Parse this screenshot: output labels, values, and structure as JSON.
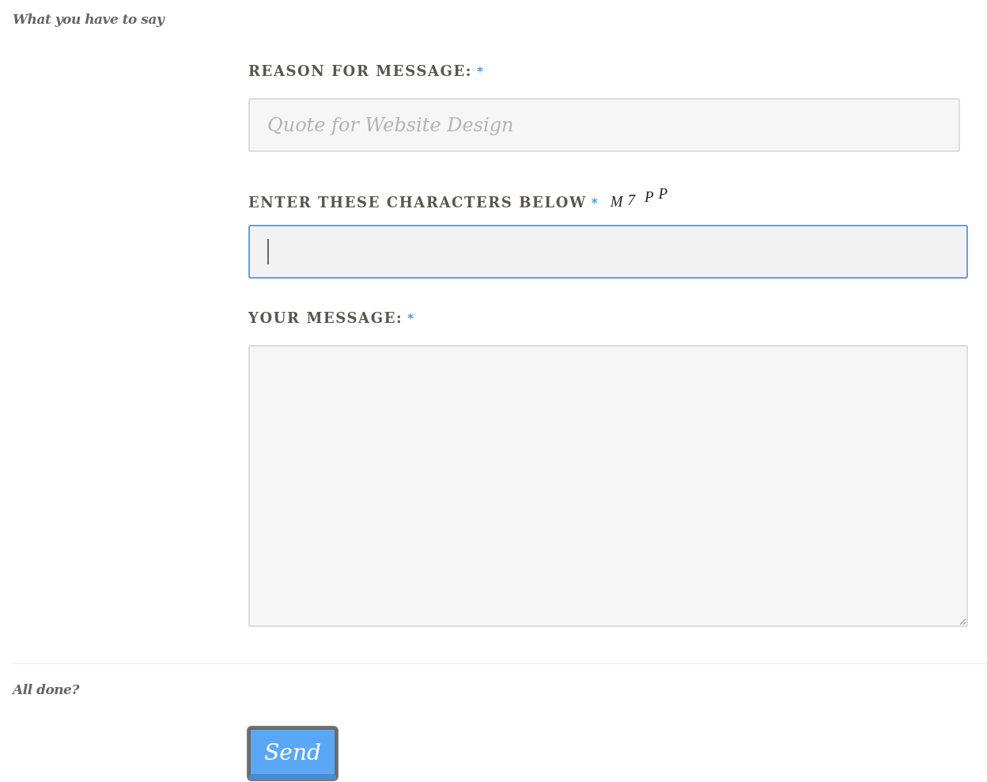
{
  "sections": [
    {
      "title": "What you have to say"
    },
    {
      "title": "All done?"
    }
  ],
  "fields": [
    {
      "kind": "input",
      "label": "REASON FOR MESSAGE:",
      "marker": "*",
      "placeholder": "Quote for Website Design",
      "focused": false
    },
    {
      "kind": "input",
      "label": "ENTER THESE CHARACTERS BELOW",
      "marker": "*",
      "captcha": [
        "M",
        "7",
        "P",
        "P"
      ],
      "focused": true
    },
    {
      "kind": "textarea",
      "label": "YOUR MESSAGE:",
      "marker": "*",
      "focused": false
    }
  ],
  "submit": {
    "label": "Send"
  }
}
